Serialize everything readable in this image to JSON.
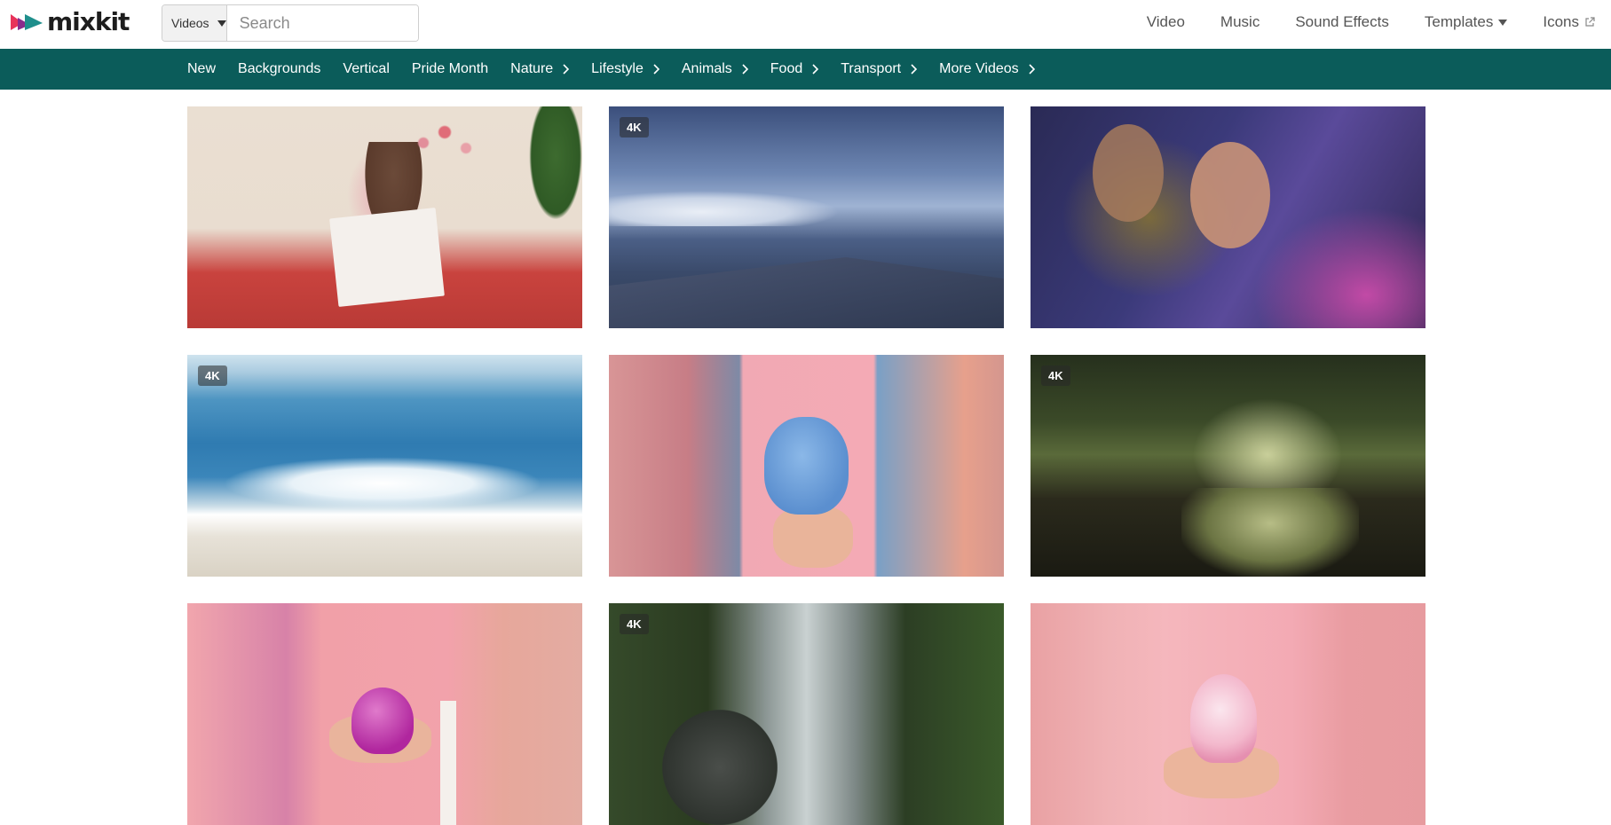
{
  "brand": {
    "name": "mixkit"
  },
  "search": {
    "category": "Videos",
    "placeholder": "Search",
    "value": ""
  },
  "topnav": [
    {
      "label": "Video"
    },
    {
      "label": "Music"
    },
    {
      "label": "Sound Effects"
    },
    {
      "label": "Templates"
    },
    {
      "label": "Icons"
    }
  ],
  "categories": [
    {
      "label": "New"
    },
    {
      "label": "Backgrounds"
    },
    {
      "label": "Vertical"
    },
    {
      "label": "Pride Month"
    },
    {
      "label": "Nature"
    },
    {
      "label": "Lifestyle"
    },
    {
      "label": "Animals"
    },
    {
      "label": "Food"
    },
    {
      "label": "Transport"
    },
    {
      "label": "More Videos"
    }
  ],
  "videos": [
    {
      "badge": ""
    },
    {
      "badge": "4K"
    },
    {
      "badge": ""
    },
    {
      "badge": "4K"
    },
    {
      "badge": ""
    },
    {
      "badge": "4K"
    },
    {
      "badge": ""
    },
    {
      "badge": "4K"
    },
    {
      "badge": ""
    }
  ],
  "colors": {
    "category_bar": "#0b5c5a",
    "logo_pink": "#e8335a",
    "logo_teal": "#1f8f8c"
  }
}
